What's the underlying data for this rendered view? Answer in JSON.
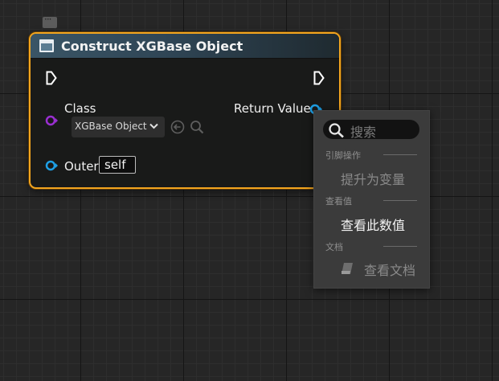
{
  "node": {
    "title": "Construct XGBase Object",
    "class_label": "Class",
    "class_value": "XGBase Object",
    "return_label": "Return Value",
    "outer_label": "Outer",
    "outer_value": "self"
  },
  "context_menu": {
    "search_placeholder": "搜索",
    "sections": [
      {
        "label": "引脚操作",
        "items": [
          {
            "label": "提升为变量",
            "enabled": false
          }
        ]
      },
      {
        "label": "查看值",
        "items": [
          {
            "label": "查看此数值",
            "enabled": true
          }
        ]
      },
      {
        "label": "文档",
        "items": [
          {
            "label": "查看文档",
            "enabled": false,
            "icon": "document-icon"
          }
        ]
      }
    ]
  },
  "colors": {
    "node_border": "#f3a51f",
    "class_pin": "#9a2fd1",
    "object_pin": "#1ea0e6",
    "exec_pin": "#ffffff"
  }
}
